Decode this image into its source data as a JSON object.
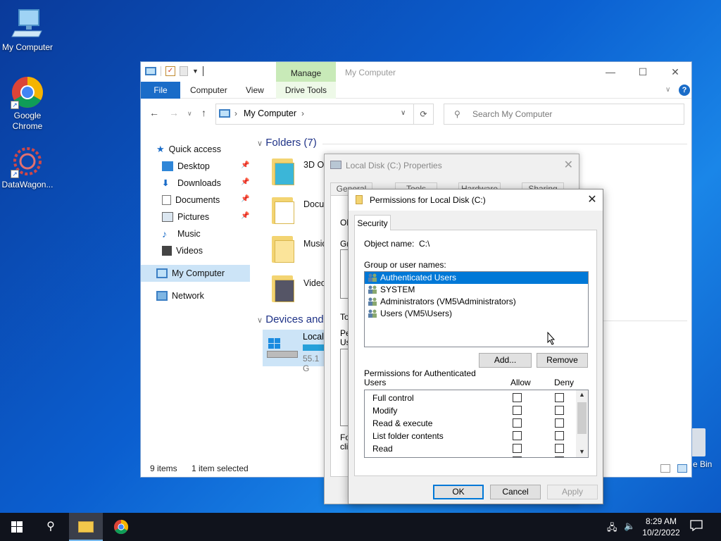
{
  "desktop": {
    "icons": [
      {
        "label": "My Computer",
        "icon": "monitor-icon"
      },
      {
        "label": "Google Chrome",
        "icon": "chrome-icon"
      },
      {
        "label": "DataWagon...",
        "icon": "datawagon-icon"
      }
    ],
    "recycle_bin_partial": "e Bin"
  },
  "explorer": {
    "title": "My Computer",
    "context_tab": "Manage",
    "context_subtab": "Drive Tools",
    "ribbon_tabs": [
      "File",
      "Computer",
      "View"
    ],
    "address": "My Computer",
    "search_placeholder": "Search My Computer",
    "nav": [
      {
        "label": "Quick access",
        "icon": "star-icon"
      },
      {
        "label": "Desktop",
        "icon": "desktop-folder-icon",
        "pinned": true
      },
      {
        "label": "Downloads",
        "icon": "download-icon",
        "pinned": true
      },
      {
        "label": "Documents",
        "icon": "documents-icon",
        "pinned": true
      },
      {
        "label": "Pictures",
        "icon": "pictures-icon",
        "pinned": true
      },
      {
        "label": "Music",
        "icon": "music-icon"
      },
      {
        "label": "Videos",
        "icon": "videos-icon"
      },
      {
        "label": "My Computer",
        "icon": "computer-icon",
        "selected": true
      },
      {
        "label": "Network",
        "icon": "network-icon"
      }
    ],
    "folders_header": "Folders (7)",
    "folders": [
      "3D Ob",
      "Docu",
      "Music",
      "Video"
    ],
    "devices_header": "Devices and",
    "drive": {
      "label": "Local",
      "free": "55.1 G"
    },
    "status_items": "9 items",
    "status_selected": "1 item selected"
  },
  "properties": {
    "title": "Local Disk (C:) Properties",
    "tabs": [
      "General",
      "Tools",
      "Hardware",
      "Sharing"
    ],
    "partial_labels": [
      "Ob",
      "Gr",
      "To",
      "Pe",
      "Us",
      "Fo",
      "clic"
    ]
  },
  "permissions": {
    "title": "Permissions for Local Disk (C:)",
    "tab": "Security",
    "object_label": "Object name:",
    "object_value": "C:\\",
    "group_label": "Group or user names:",
    "users": [
      {
        "name": "Authenticated Users",
        "selected": true
      },
      {
        "name": "SYSTEM",
        "selected": false
      },
      {
        "name": "Administrators (VM5\\Administrators)",
        "selected": false
      },
      {
        "name": "Users (VM5\\Users)",
        "selected": false
      }
    ],
    "add_button": "Add...",
    "remove_button": "Remove",
    "perm_header_line1": "Permissions for Authenticated",
    "perm_header_line2": "Users",
    "allow_label": "Allow",
    "deny_label": "Deny",
    "permissions": [
      "Full control",
      "Modify",
      "Read & execute",
      "List folder contents",
      "Read"
    ],
    "ok_button": "OK",
    "cancel_button": "Cancel",
    "apply_button": "Apply"
  },
  "taskbar": {
    "time": "8:29 AM",
    "date": "10/2/2022"
  }
}
